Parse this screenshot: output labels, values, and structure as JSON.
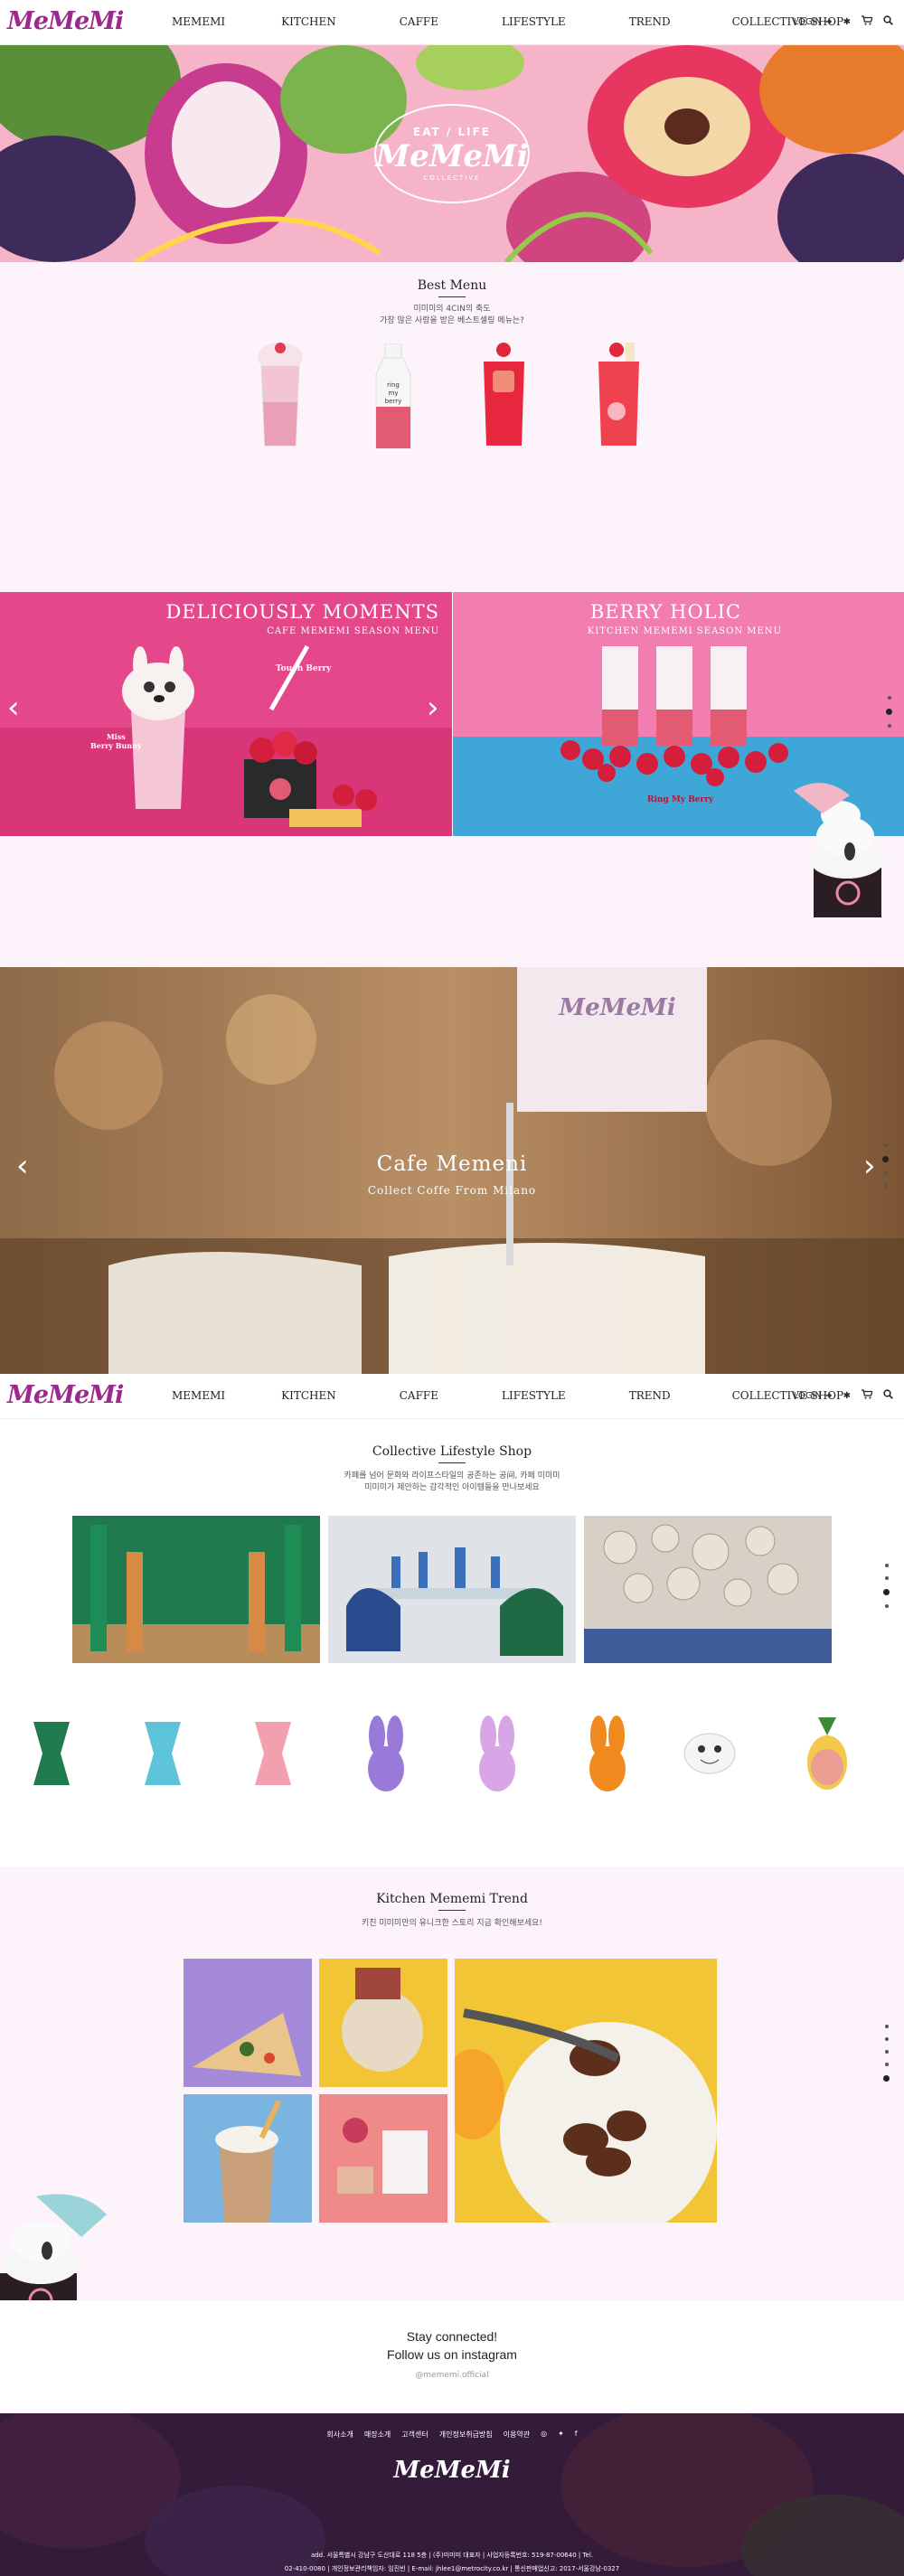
{
  "nav": {
    "logo": "MeMeMi",
    "menu": [
      "MEMEMI",
      "KITCHEN",
      "CAFFE",
      "LIFESTYLE",
      "TREND",
      "COLLECTIVE SHOP"
    ],
    "login": "LOGIN"
  },
  "hero": {
    "badge_top": "EAT / LIFE",
    "badge_brand": "MeMeMi",
    "badge_sub": "COLLECTIVE"
  },
  "best_menu": {
    "title": "Best Menu",
    "desc_line1": "미미미의 4CIN의 축도",
    "desc_line2": "가장 많은 사랑을 받은 베스트셀링 메뉴는?"
  },
  "promo_left": {
    "title": "DELICIOUSLY MOMENTS",
    "subtitle": "CAFE MEMEMI SEASON MENU",
    "tag1": "Touch Berry",
    "tag2_line1": "Miss",
    "tag2_line2": "Berry Bunny"
  },
  "promo_right": {
    "title": "BERRY HOLIC",
    "subtitle": "KITCHEN MEMEMI SEASON MENU",
    "tag": "Ring My Berry"
  },
  "cafe": {
    "title": "Cafe Memeni",
    "subtitle": "Collect Coffe From Milano",
    "sign_brand": "MeMeMi"
  },
  "lifestyle": {
    "title": "Collective Lifestyle Shop",
    "desc_line1": "카페를 넘어 문화와 라이프스타일의 공존하는 공间, 카페 미미미",
    "desc_line2": "미미미가 제안하는 감각적인 아이템들을 만나보세요"
  },
  "trend": {
    "title": "Kitchen Mememi Trend",
    "desc": "키친 미미미만의 유니크한 스토리 지금 확인해보세요!"
  },
  "instagram": {
    "line1": "Stay connected!",
    "line2": "Follow us on instagram",
    "handle": "@mememi.official"
  },
  "footer": {
    "links": [
      "회사소개",
      "매장소개",
      "고객센터",
      "개인정보취급방침",
      "이용약관"
    ],
    "brand": "MeMeMi",
    "info_line1": "add. 서울특별시 강남구 도산대로 118 5층 | (주)미미미 대표자 | 사업자등록번호: 519-87-00640 | Tel.",
    "info_line2": "02-410-0080 | 개인정보관리책임자: 임진빈 | E-mail: jhlee1@metrocity.co.kr | 통신판매업신고: 2017-서울강남-0327"
  },
  "colors": {
    "brand": "#9c2a8c",
    "section_pink": "#fdf3fb",
    "promo_left": "#e5478b",
    "promo_right": "#f27db1",
    "footer": "#3d2340"
  }
}
